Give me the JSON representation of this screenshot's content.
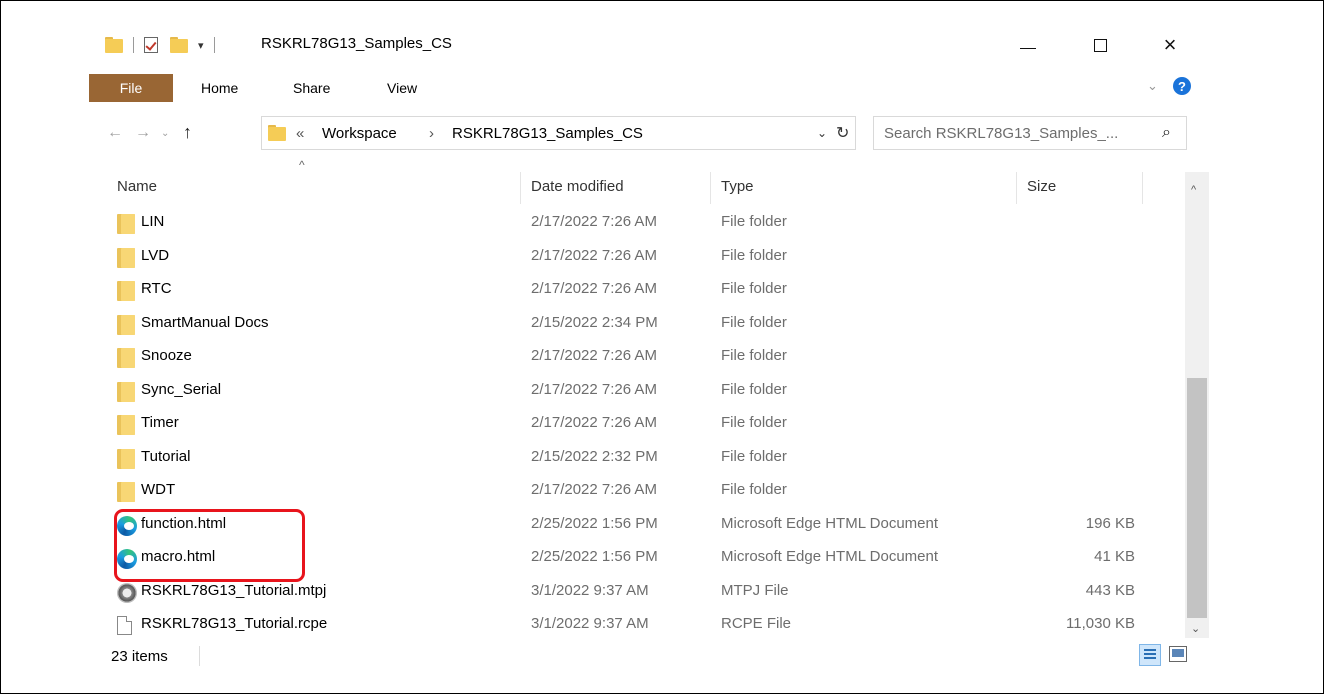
{
  "window": {
    "title": "RSKRL78G13_Samples_CS",
    "controls": {
      "minimize": "minimize",
      "maximize": "maximize",
      "close": "×"
    }
  },
  "ribbon": {
    "tabs": [
      {
        "label": "File"
      },
      {
        "label": "Home"
      },
      {
        "label": "Share"
      },
      {
        "label": "View"
      }
    ],
    "help": "?"
  },
  "nav": {
    "back": "←",
    "forward": "→",
    "recent": "⌄",
    "up": "↑"
  },
  "address": {
    "overflow": "«",
    "crumbs": [
      "Workspace",
      "RSKRL78G13_Samples_CS"
    ],
    "separator": "›",
    "dropdown": "⌄",
    "refresh": "↻"
  },
  "search": {
    "placeholder": "Search RSKRL78G13_Samples_...",
    "icon": "⌕"
  },
  "columns": {
    "name": "Name",
    "date": "Date modified",
    "type": "Type",
    "size": "Size",
    "sort_caret": "^"
  },
  "files": [
    {
      "name": "LIN",
      "date": "2/17/2022 7:26 AM",
      "type": "File folder",
      "size": "",
      "icon": "folder-icon"
    },
    {
      "name": "LVD",
      "date": "2/17/2022 7:26 AM",
      "type": "File folder",
      "size": "",
      "icon": "folder-icon"
    },
    {
      "name": "RTC",
      "date": "2/17/2022 7:26 AM",
      "type": "File folder",
      "size": "",
      "icon": "folder-icon"
    },
    {
      "name": "SmartManual Docs",
      "date": "2/15/2022 2:34 PM",
      "type": "File folder",
      "size": "",
      "icon": "folder-icon"
    },
    {
      "name": "Snooze",
      "date": "2/17/2022 7:26 AM",
      "type": "File folder",
      "size": "",
      "icon": "folder-icon"
    },
    {
      "name": "Sync_Serial",
      "date": "2/17/2022 7:26 AM",
      "type": "File folder",
      "size": "",
      "icon": "folder-icon"
    },
    {
      "name": "Timer",
      "date": "2/17/2022 7:26 AM",
      "type": "File folder",
      "size": "",
      "icon": "folder-icon"
    },
    {
      "name": "Tutorial",
      "date": "2/15/2022 2:32 PM",
      "type": "File folder",
      "size": "",
      "icon": "folder-icon"
    },
    {
      "name": "WDT",
      "date": "2/17/2022 7:26 AM",
      "type": "File folder",
      "size": "",
      "icon": "folder-icon"
    },
    {
      "name": "function.html",
      "date": "2/25/2022 1:56 PM",
      "type": "Microsoft Edge HTML Document",
      "size": "196 KB",
      "icon": "edge-icon"
    },
    {
      "name": "macro.html",
      "date": "2/25/2022 1:56 PM",
      "type": "Microsoft Edge HTML Document",
      "size": "41 KB",
      "icon": "edge-icon"
    },
    {
      "name": "RSKRL78G13_Tutorial.mtpj",
      "date": "3/1/2022 9:37 AM",
      "type": "MTPJ File",
      "size": "443 KB",
      "icon": "mtpj-icon"
    },
    {
      "name": "RSKRL78G13_Tutorial.rcpe",
      "date": "3/1/2022 9:37 AM",
      "type": "RCPE File",
      "size": "11,030 KB",
      "icon": "document-icon"
    }
  ],
  "scrollbar": {
    "up": "^",
    "down": "⌄"
  },
  "status": {
    "item_count": "23 items"
  },
  "colors": {
    "file_tab": "#996634",
    "highlight": "#e8141c",
    "folder": "#f5cc56",
    "help": "#1a73d9"
  }
}
